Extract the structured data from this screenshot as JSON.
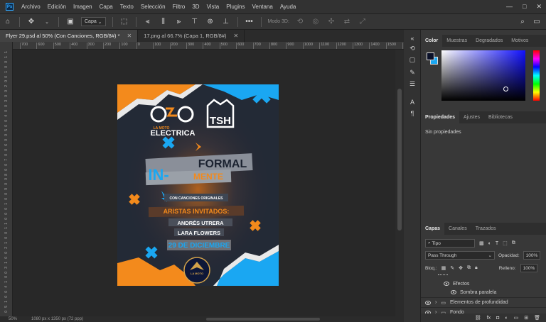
{
  "app": {
    "logo": "Ps"
  },
  "menu": [
    "Archivo",
    "Edición",
    "Imagen",
    "Capa",
    "Texto",
    "Selección",
    "Filtro",
    "3D",
    "Vista",
    "Plugins",
    "Ventana",
    "Ayuda"
  ],
  "window_controls": {
    "minimize": "—",
    "maximize": "□",
    "close": "✕"
  },
  "options_bar": {
    "layer_dropdown": "Capa",
    "mode3d_label": "Modo 3D:",
    "more": "•••"
  },
  "tabs": [
    {
      "label": "Flyer 29.psd al 50% (Con Canciones, RGB/8#) *",
      "close": "✕",
      "active": true
    },
    {
      "label": "17.png al 66.7% (Capa 1, RGB/8#)",
      "close": "✕",
      "active": false
    }
  ],
  "ruler_h": [
    "700",
    "600",
    "500",
    "400",
    "300",
    "200",
    "100",
    "0",
    "100",
    "200",
    "300",
    "400",
    "500",
    "600",
    "700",
    "800",
    "900",
    "1000",
    "1100",
    "1200",
    "1300",
    "1400",
    "1500",
    "1600",
    "1700",
    "1800"
  ],
  "ruler_v": [
    "1",
    "1",
    "0",
    "0",
    "1",
    "0",
    "0",
    "2",
    "0",
    "0",
    "3",
    "0",
    "0",
    "4",
    "0",
    "0",
    "5",
    "0",
    "0",
    "6",
    "0",
    "0",
    "7",
    "0",
    "0",
    "8",
    "0",
    "0",
    "9",
    "0",
    "0",
    "1",
    "0",
    "0",
    "0",
    "1",
    "1",
    "0",
    "0",
    "1",
    "2",
    "0",
    "0",
    "1",
    "3",
    "0",
    "0",
    "1",
    "4",
    "0",
    "0",
    "1",
    "5",
    "0"
  ],
  "status": {
    "zoom": "50%",
    "doc_size": "1080 px x 1350 px (72 ppp)"
  },
  "flyer": {
    "brand_left_top": "LA MOTO",
    "brand_left": "ELECTRICA",
    "brand_right": "TSH",
    "title_in": "IN-",
    "title_formal": "FORMAL",
    "title_mente": "MENTE",
    "subtitle": "CON CANCIONES ORIGINALES",
    "guests_heading": "ARISTAS INVITADOS:",
    "guest1": "ANDRÉS UTRERA",
    "guest2": "LARA FLOWERS",
    "date": "29 DE DICIEMBRE",
    "badge": "LA MOTO"
  },
  "panels": {
    "color_tabs": [
      "Color",
      "Muestras",
      "Degradados",
      "Motivos"
    ],
    "props_tabs": [
      "Propiedades",
      "Ajustes",
      "Bibliotecas"
    ],
    "props_empty": "Sin propiedades",
    "layers_tabs": [
      "Capas",
      "Canales",
      "Trazados"
    ],
    "filter_label": "Tipo",
    "blend_mode": "Pass Through",
    "opacity_label": "Opacidad:",
    "opacity_value": "100%",
    "lock_label": "Bloq.:",
    "fill_label": "Relleno:",
    "fill_value": "100%",
    "layers": [
      {
        "name": "Efectos"
      },
      {
        "name": "Sombra paralela"
      },
      {
        "name": "Elementos de profundidad"
      },
      {
        "name": "Fondo"
      }
    ]
  },
  "colors": {
    "accent_orange": "#f38a1c",
    "accent_blue": "#1aa7f2",
    "flyer_bg": "#1f2530"
  }
}
